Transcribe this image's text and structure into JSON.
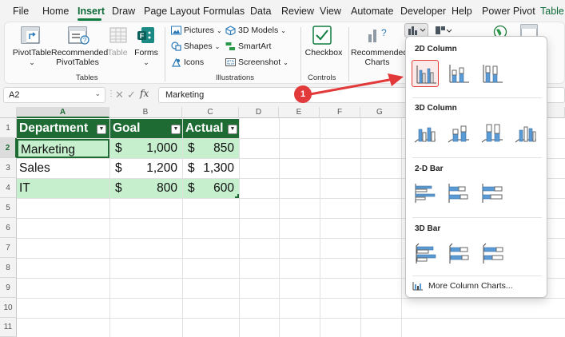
{
  "menu": {
    "tabs": [
      "File",
      "Home",
      "Insert",
      "Draw",
      "Page Layout",
      "Formulas",
      "Data",
      "Review",
      "View",
      "Automate",
      "Developer",
      "Help",
      "Power Pivot",
      "Table D"
    ],
    "active": "Insert"
  },
  "ribbon": {
    "tables": {
      "pivot": "PivotTable",
      "pivot_arrow": "⌄",
      "rec1": "Recommended",
      "rec2": "PivotTables",
      "table": "Table",
      "forms": "Forms",
      "forms_arrow": "⌄",
      "group": "Tables"
    },
    "illustrations": {
      "pictures": "Pictures",
      "shapes": "Shapes",
      "icons": "Icons",
      "models": "3D Models",
      "smartart": "SmartArt",
      "screenshot": "Screenshot",
      "group": "Illustrations"
    },
    "controls": {
      "checkbox": "Checkbox",
      "group": "Controls"
    },
    "charts": {
      "rec1": "Recommended",
      "rec2": "Charts"
    }
  },
  "formula_bar": {
    "namebox": "A2",
    "fx": "fx",
    "value": "Marketing"
  },
  "grid": {
    "columns": [
      "A",
      "B",
      "C",
      "D",
      "E",
      "F",
      "G"
    ],
    "rows": [
      "1",
      "2",
      "3",
      "4",
      "5",
      "6",
      "7",
      "8",
      "9",
      "10",
      "11"
    ],
    "header": [
      "Department",
      "Goal",
      "Actual"
    ],
    "data": [
      {
        "dept": "Marketing",
        "goal_cur": "$",
        "goal": "1,000",
        "act_cur": "$",
        "actual": "850"
      },
      {
        "dept": "Sales",
        "goal_cur": "$",
        "goal": "1,200",
        "act_cur": "$",
        "actual": "1,300"
      },
      {
        "dept": "IT",
        "goal_cur": "$",
        "goal": "800",
        "act_cur": "$",
        "actual": "600"
      }
    ]
  },
  "dropdown": {
    "sec1": "2D Column",
    "sec2": "3D Column",
    "sec3": "2-D Bar",
    "sec4": "3D Bar",
    "more": "More Column Charts..."
  },
  "callout": {
    "number": "1"
  },
  "colors": {
    "accent": "#0f7b3f",
    "table_header": "#1e6b34",
    "band": "#c6efce",
    "callout": "#e23a3a",
    "chart_blue": "#5b9bd5"
  }
}
